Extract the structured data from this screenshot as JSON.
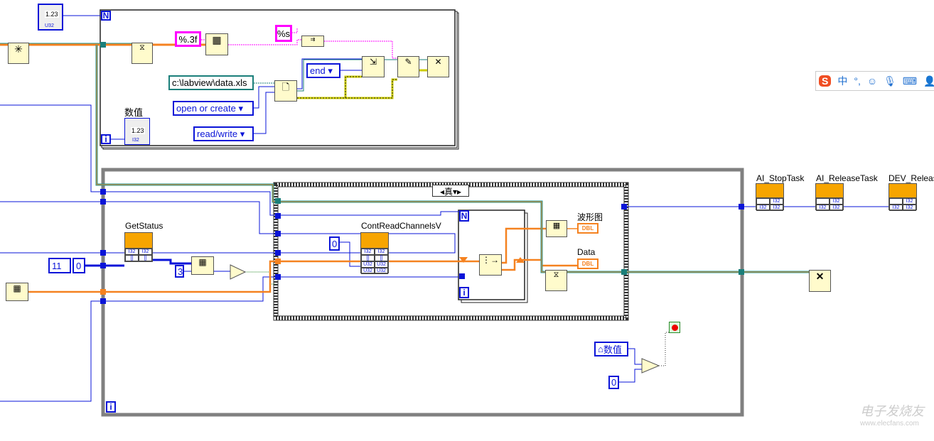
{
  "top_control": {
    "value": "1.23",
    "type": "U32"
  },
  "for_loop": {
    "count_terminal": "N",
    "iteration_terminal": "i"
  },
  "constants": {
    "format_float": "%.3f",
    "format_string": "%s",
    "file_path": "c:\\labview\\data.xls",
    "position_mode": "end",
    "open_operation": "open or create",
    "access_mode": "read/write",
    "array_index": "3",
    "device_count": "11",
    "device_zero": "0",
    "channel_zero": "0",
    "compare_zero": "0"
  },
  "indicator": {
    "label": "数值",
    "value": "1.23",
    "type": "I32"
  },
  "while_loop": {
    "iteration_terminal": "i"
  },
  "case_structure": {
    "selector": "真"
  },
  "inner_for_loop": {
    "count_terminal": "N",
    "iteration_terminal": "i"
  },
  "nodes": {
    "get_status": "GetStatus",
    "cont_read": "ContReadChannelsV",
    "stop_task": "AI_StopTask",
    "release_task": "AI_ReleaseTask",
    "dev_release": "DEV_Release"
  },
  "outputs": {
    "waveform_label": "波形图",
    "data_label": "Data",
    "dbl_type": "DBL"
  },
  "local_variable": {
    "label": "数值"
  },
  "ime_toolbar": {
    "mode": "中",
    "punct": "°,"
  },
  "watermark": {
    "text": "电子发烧友",
    "url_text": "www.elecfans.com"
  },
  "colors": {
    "int_wire": "#0a14d8",
    "dbl_wire": "#f58220",
    "string_wire": "#ff00ff",
    "path_wire": "#1a7f7a",
    "dll_node": "#f7a500",
    "node_bg": "#fffbcc",
    "loop_border": "#808080"
  }
}
